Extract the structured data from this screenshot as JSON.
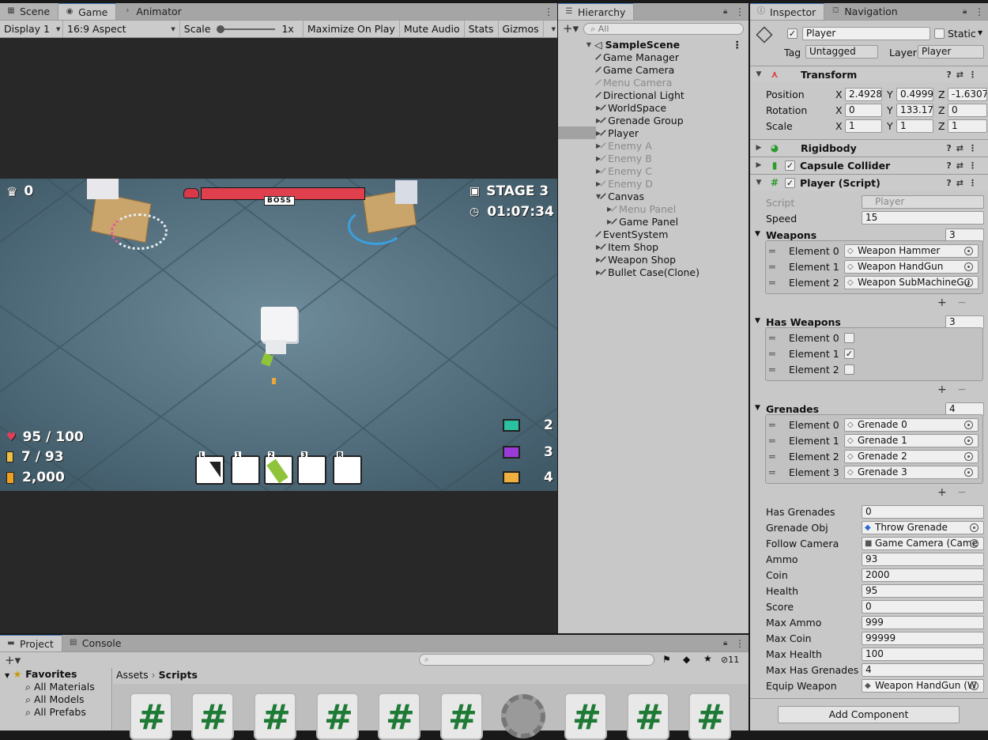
{
  "scene_panel": {
    "tabs": [
      "Scene",
      "Game",
      "Animator"
    ],
    "active_tab": "Game",
    "toolbar": {
      "display": "Display 1",
      "aspect": "16:9 Aspect",
      "scale_label": "Scale",
      "scale_value": "1x",
      "maximize": "Maximize On Play",
      "mute": "Mute Audio",
      "stats": "Stats",
      "gizmos": "Gizmos"
    }
  },
  "game_hud": {
    "score": "0",
    "boss_label": "BOSS",
    "stage": "STAGE 3",
    "time": "01:07:34",
    "health": "95 / 100",
    "ammo": "7 / 93",
    "coin": "2,000",
    "enemy_counts": [
      "2",
      "3",
      "4"
    ],
    "slots": [
      "L",
      "1",
      "2",
      "3",
      "R"
    ],
    "boss_health_fraction": 1.0
  },
  "hierarchy": {
    "tab": "Hierarchy",
    "search_placeholder": "All",
    "scene": "SampleScene",
    "items": [
      {
        "label": "Game Manager",
        "depth": 1,
        "arrow": false,
        "greyed": false,
        "selected": false
      },
      {
        "label": "Game Camera",
        "depth": 1,
        "arrow": false,
        "greyed": false,
        "selected": false
      },
      {
        "label": "Menu Camera",
        "depth": 1,
        "arrow": false,
        "greyed": true,
        "selected": false
      },
      {
        "label": "Directional Light",
        "depth": 1,
        "arrow": false,
        "greyed": false,
        "selected": false
      },
      {
        "label": "WorldSpace",
        "depth": 1,
        "arrow": true,
        "greyed": false,
        "selected": false
      },
      {
        "label": "Grenade Group",
        "depth": 1,
        "arrow": true,
        "greyed": false,
        "selected": false
      },
      {
        "label": "Player",
        "depth": 1,
        "arrow": true,
        "greyed": false,
        "selected": true
      },
      {
        "label": "Enemy A",
        "depth": 1,
        "arrow": true,
        "greyed": true,
        "selected": false
      },
      {
        "label": "Enemy B",
        "depth": 1,
        "arrow": true,
        "greyed": true,
        "selected": false
      },
      {
        "label": "Enemy C",
        "depth": 1,
        "arrow": true,
        "greyed": true,
        "selected": false
      },
      {
        "label": "Enemy D",
        "depth": 1,
        "arrow": true,
        "greyed": true,
        "selected": false
      },
      {
        "label": "Canvas",
        "depth": 1,
        "arrow": "open",
        "greyed": false,
        "selected": false
      },
      {
        "label": "Menu Panel",
        "depth": 2,
        "arrow": true,
        "greyed": true,
        "selected": false
      },
      {
        "label": "Game Panel",
        "depth": 2,
        "arrow": true,
        "greyed": false,
        "selected": false
      },
      {
        "label": "EventSystem",
        "depth": 1,
        "arrow": false,
        "greyed": false,
        "selected": false
      },
      {
        "label": "Item Shop",
        "depth": 1,
        "arrow": true,
        "greyed": false,
        "selected": false
      },
      {
        "label": "Weapon Shop",
        "depth": 1,
        "arrow": true,
        "greyed": false,
        "selected": false
      },
      {
        "label": "Bullet Case(Clone)",
        "depth": 1,
        "arrow": true,
        "greyed": false,
        "selected": false
      }
    ]
  },
  "inspector": {
    "tabs": [
      "Inspector",
      "Navigation"
    ],
    "object_name": "Player",
    "static_label": "Static",
    "tag_label": "Tag",
    "tag_value": "Untagged",
    "layer_label": "Layer",
    "layer_value": "Player",
    "transform": {
      "title": "Transform",
      "position_label": "Position",
      "rotation_label": "Rotation",
      "scale_label": "Scale",
      "position": [
        "2.49287",
        "0.49999",
        "-1.6307"
      ],
      "rotation": [
        "0",
        "133.171",
        "0"
      ],
      "scale": [
        "1",
        "1",
        "1"
      ],
      "axes": [
        "X",
        "Y",
        "Z"
      ]
    },
    "rigidbody": "Rigidbody",
    "capsule": "Capsule Collider",
    "script_title": "Player (Script)",
    "script_label": "Script",
    "script_value": "Player",
    "speed_label": "Speed",
    "speed_value": "15",
    "weapons": {
      "label": "Weapons",
      "count": "3",
      "items": [
        {
          "label": "Element 0",
          "value": "Weapon Hammer"
        },
        {
          "label": "Element 1",
          "value": "Weapon HandGun"
        },
        {
          "label": "Element 2",
          "value": "Weapon SubMachineGu"
        }
      ]
    },
    "has_weapons": {
      "label": "Has Weapons",
      "count": "3",
      "items": [
        {
          "label": "Element 0",
          "checked": false
        },
        {
          "label": "Element 1",
          "checked": true
        },
        {
          "label": "Element 2",
          "checked": false
        }
      ]
    },
    "grenades": {
      "label": "Grenades",
      "count": "4",
      "items": [
        {
          "label": "Element 0",
          "value": "Grenade 0"
        },
        {
          "label": "Element 1",
          "value": "Grenade 1"
        },
        {
          "label": "Element 2",
          "value": "Grenade 2"
        },
        {
          "label": "Element 3",
          "value": "Grenade 3"
        }
      ]
    },
    "fields": [
      {
        "label": "Has Grenades",
        "value": "0"
      },
      {
        "label": "Grenade Obj",
        "value": "Throw Grenade"
      },
      {
        "label": "Follow Camera",
        "value": "Game Camera (Came"
      },
      {
        "label": "Ammo",
        "value": "93"
      },
      {
        "label": "Coin",
        "value": "2000"
      },
      {
        "label": "Health",
        "value": "95"
      },
      {
        "label": "Score",
        "value": "0"
      },
      {
        "label": "Max Ammo",
        "value": "999"
      },
      {
        "label": "Max Coin",
        "value": "99999"
      },
      {
        "label": "Max Health",
        "value": "100"
      },
      {
        "label": "Max Has Grenades",
        "value": "4"
      },
      {
        "label": "Equip Weapon",
        "value": "Weapon HandGun (W"
      }
    ],
    "add_component": "Add Component"
  },
  "project": {
    "tabs": [
      "Project",
      "Console"
    ],
    "favorites": "Favorites",
    "fav_items": [
      "All Materials",
      "All Models",
      "All Prefabs"
    ],
    "breadcrumb": [
      "Assets",
      "Scripts"
    ],
    "hidden_count": "11"
  },
  "colors": {
    "selection": "#a2a2a2",
    "game_floor": "#4c6877",
    "boss_bar": "#e0404e",
    "tab_accent": "#3a72b0"
  }
}
